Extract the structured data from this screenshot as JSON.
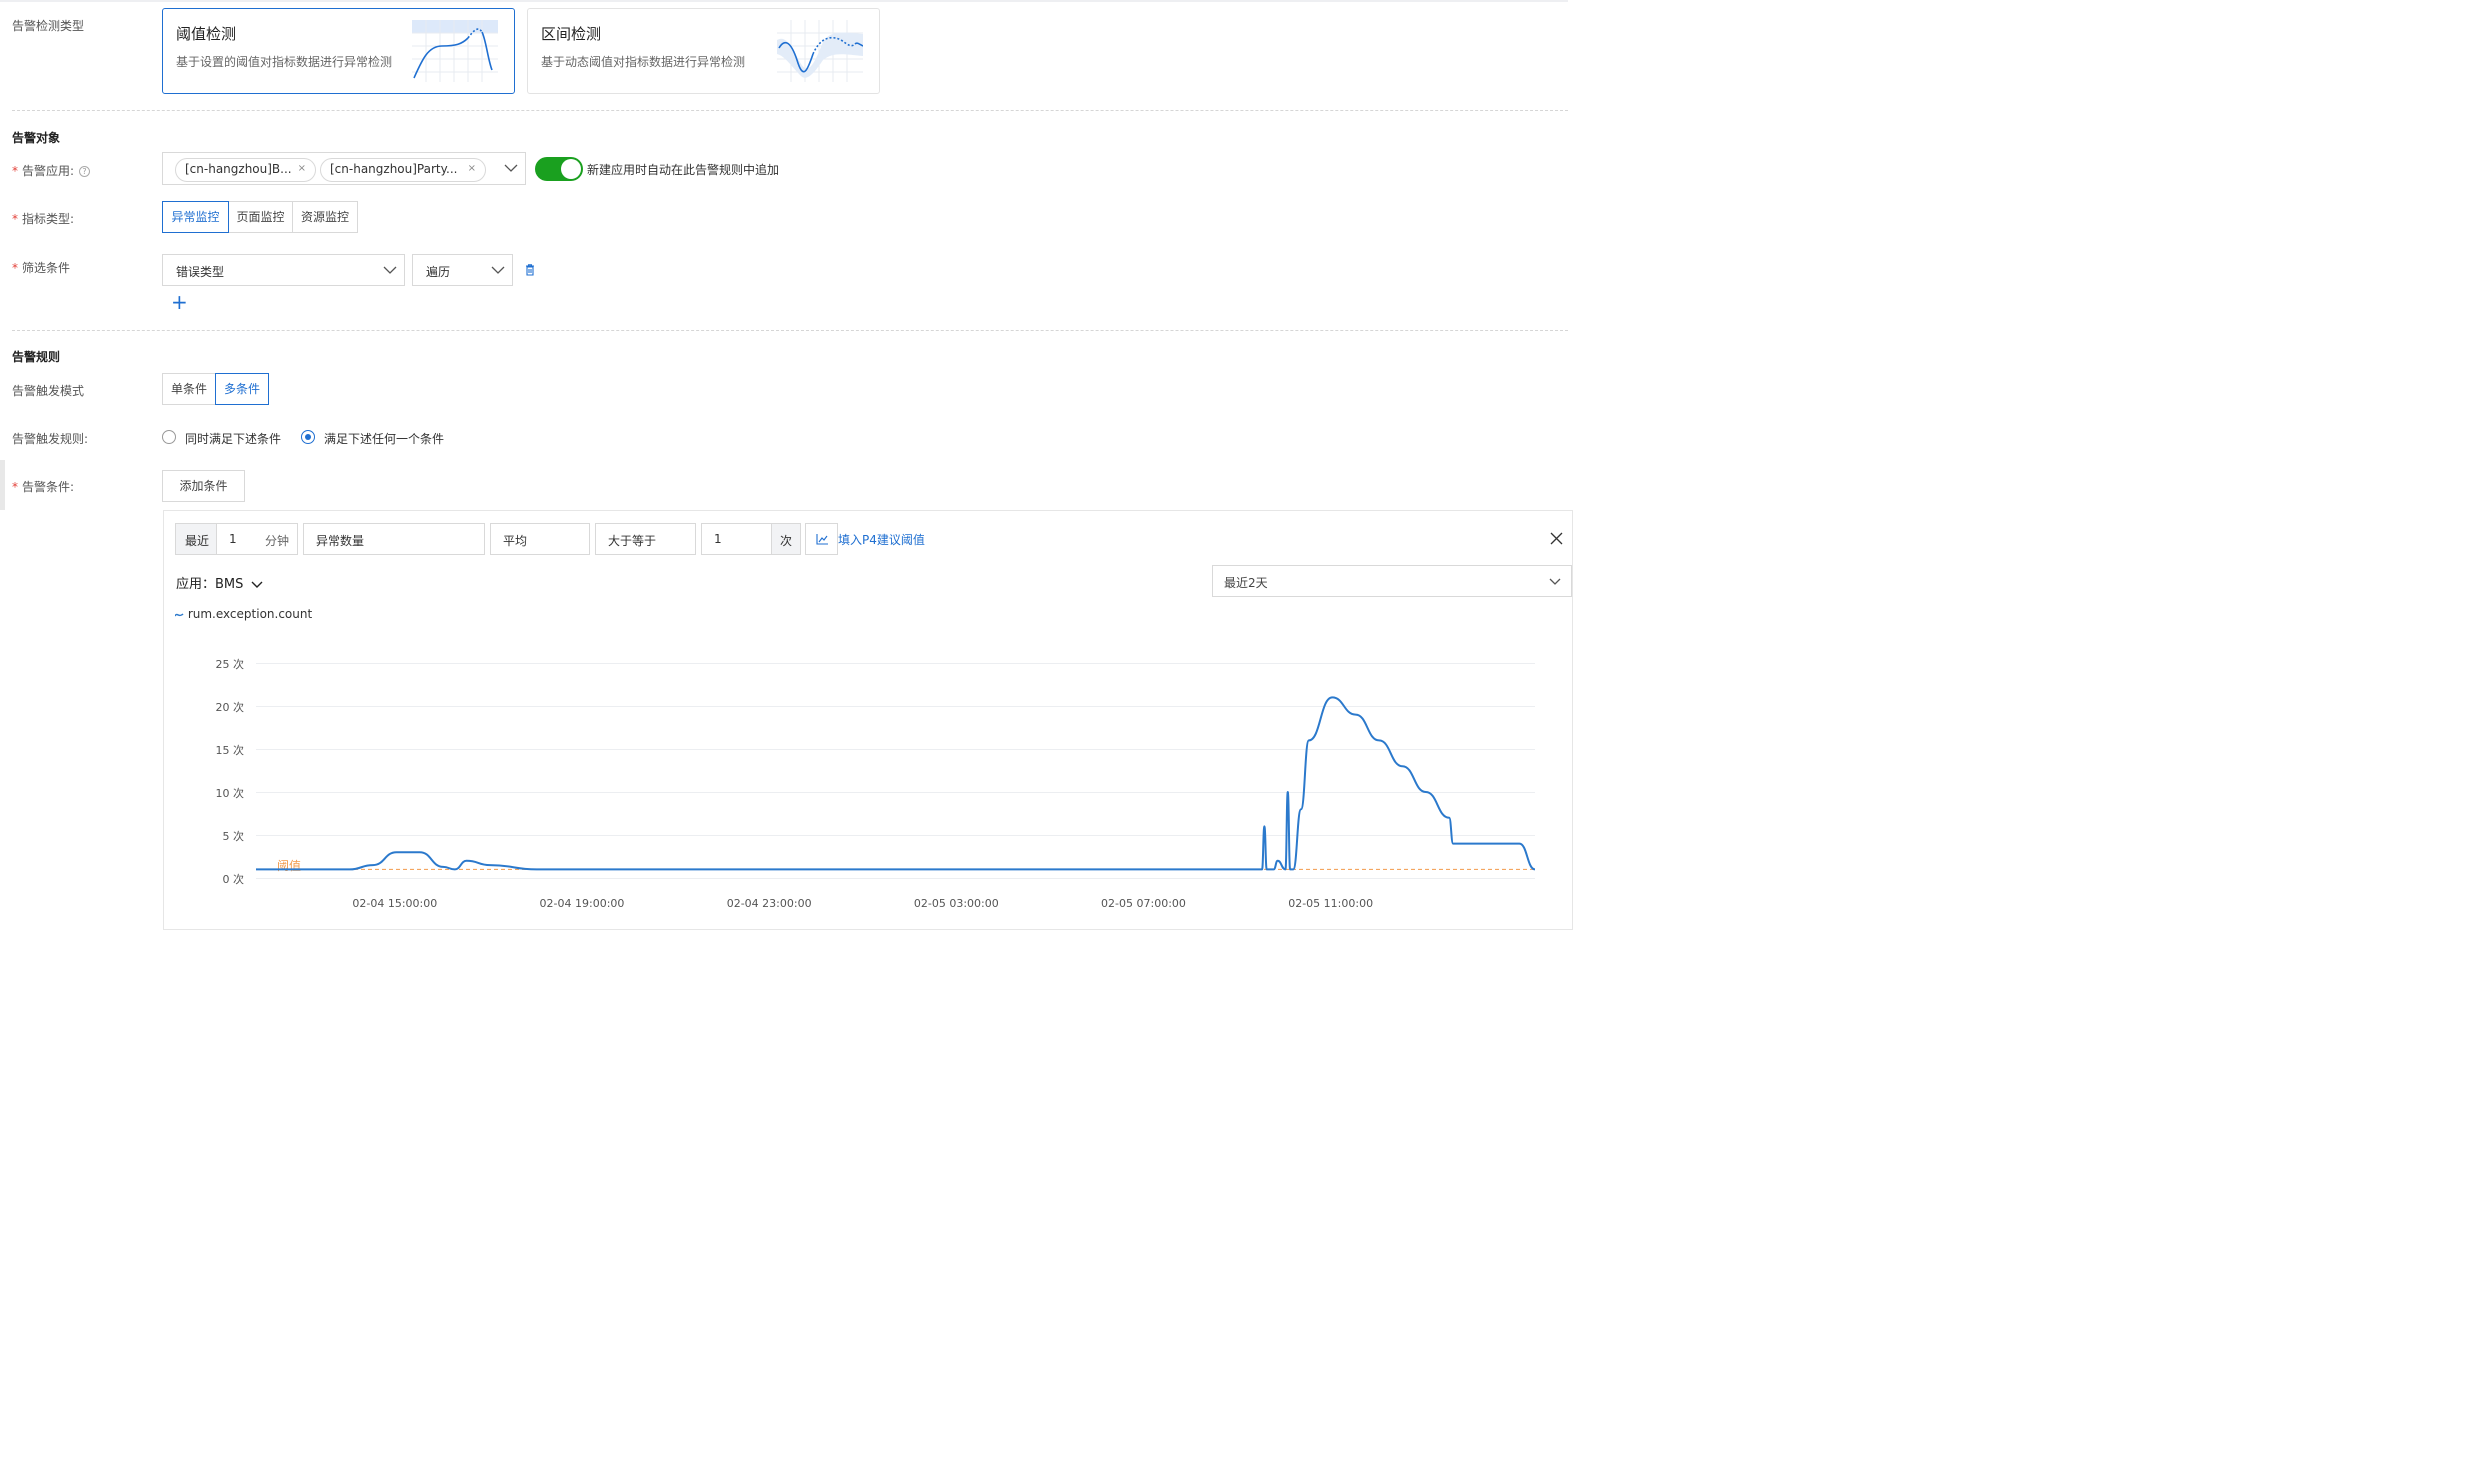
{
  "detection": {
    "label": "告警检测类型",
    "cards": [
      {
        "title": "阈值检测",
        "desc": "基于设置的阈值对指标数据进行异常检测",
        "selected": true
      },
      {
        "title": "区间检测",
        "desc": "基于动态阈值对指标数据进行异常检测",
        "selected": false
      }
    ]
  },
  "target": {
    "section_title": "告警对象",
    "app_label": "告警应用:",
    "app_tags": [
      "[cn-hangzhou]B...",
      "[cn-hangzhou]Party..."
    ],
    "auto_add_text": "新建应用时自动在此告警规则中追加",
    "auto_add_on": true,
    "metric_label": "指标类型:",
    "metric_types": [
      "异常监控",
      "页面监控",
      "资源监控"
    ],
    "metric_selected": "异常监控",
    "filter_label": "筛选条件",
    "filter_field": "错误类型",
    "filter_op": "遍历",
    "add_symbol": "+"
  },
  "rules": {
    "section_title": "告警规则",
    "mode_label": "告警触发模式",
    "modes": [
      "单条件",
      "多条件"
    ],
    "mode_selected": "多条件",
    "rule_label": "告警触发规则:",
    "rule_options": [
      "同时满足下述条件",
      "满足下述任何一个条件"
    ],
    "rule_selected": "满足下述任何一个条件",
    "cond_label": "告警条件:",
    "add_cond_button": "添加条件"
  },
  "condition": {
    "recent_label": "最近",
    "minutes_value": "1",
    "minutes_unit": "分钟",
    "metric": "异常数量",
    "aggregation": "平均",
    "operator": "大于等于",
    "threshold_value": "1",
    "threshold_unit": "次",
    "suggest_link": "填入P4建议阈值",
    "app_prefix": "应用：",
    "app_name": "BMS",
    "range": "最近2天",
    "legend": "rum.exception.count",
    "threshold_label": "阈值"
  },
  "colors": {
    "primary": "#1f6fd1",
    "line": "#2b79cc",
    "threshold": "#f29a4a",
    "toggle": "#1aa01f",
    "required": "#e3423a"
  },
  "chart_data": {
    "type": "line",
    "series": [
      {
        "name": "rum.exception.count"
      }
    ],
    "x": [
      "02-04 12:00",
      "02-04 13:00",
      "02-04 14:00",
      "02-04 14:30",
      "02-04 15:00",
      "02-04 15:30",
      "02-04 16:00",
      "02-04 16:15",
      "02-04 16:30",
      "02-04 17:00",
      "02-04 18:00",
      "02-04 20:00",
      "02-05 00:00",
      "02-05 04:00",
      "02-05 08:00",
      "02-05 09:30",
      "02-05 09:33",
      "02-05 09:36",
      "02-05 09:45",
      "02-05 09:50",
      "02-05 10:00",
      "02-05 10:03",
      "02-05 10:06",
      "02-05 10:10",
      "02-05 10:20",
      "02-05 10:30",
      "02-05 11:00",
      "02-05 11:30",
      "02-05 12:00",
      "02-05 12:30",
      "02-05 13:00",
      "02-05 13:30",
      "02-05 13:35",
      "02-05 14:00",
      "02-05 15:00",
      "02-05 15:20"
    ],
    "values": [
      1,
      1,
      1,
      1.5,
      3,
      3,
      1.3,
      1,
      2,
      1.5,
      1,
      1,
      1,
      1,
      1,
      1,
      6,
      1,
      1,
      2,
      1,
      10,
      1,
      1,
      8,
      16,
      21,
      19,
      16,
      13,
      10,
      7,
      4,
      4,
      4,
      1
    ],
    "threshold": 1,
    "ylim": [
      0,
      25
    ],
    "yticks": [
      0,
      5,
      10,
      15,
      20,
      25
    ],
    "ytick_labels": [
      "0 次",
      "5 次",
      "10 次",
      "15 次",
      "20 次",
      "25 次"
    ],
    "xticks": [
      "02-04 15:00:00",
      "02-04 19:00:00",
      "02-04 23:00:00",
      "02-05 03:00:00",
      "02-05 07:00:00",
      "02-05 11:00:00"
    ],
    "grid": true
  }
}
